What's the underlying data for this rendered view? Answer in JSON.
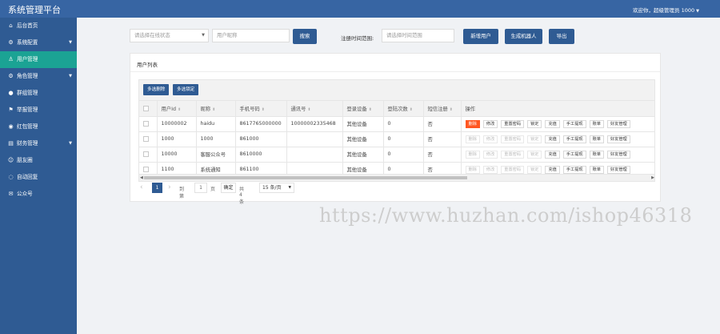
{
  "app": {
    "title": "系统管理平台",
    "welcome": "欢迎你，超级管理员 1000"
  },
  "sidebar": {
    "items": [
      {
        "label": "后台首页",
        "icon": "home-icon",
        "glyph": "⌂",
        "expandable": false,
        "active": false
      },
      {
        "label": "系统配置",
        "icon": "gear-icon",
        "glyph": "⚙",
        "expandable": true,
        "active": false
      },
      {
        "label": "用户管理",
        "icon": "user-icon",
        "glyph": "♙",
        "expandable": false,
        "active": true
      },
      {
        "label": "角色管理",
        "icon": "gear-icon",
        "glyph": "⚙",
        "expandable": true,
        "active": false
      },
      {
        "label": "群组管理",
        "icon": "circle-icon",
        "glyph": "●",
        "expandable": false,
        "active": false
      },
      {
        "label": "举报管理",
        "icon": "flag-icon",
        "glyph": "⚑",
        "expandable": false,
        "active": false
      },
      {
        "label": "红包管理",
        "icon": "radio-icon",
        "glyph": "◉",
        "expandable": false,
        "active": false
      },
      {
        "label": "财务管理",
        "icon": "wallet-icon",
        "glyph": "▤",
        "expandable": true,
        "active": false
      },
      {
        "label": "朋友圈",
        "icon": "friends-icon",
        "glyph": "☺",
        "expandable": false,
        "active": false
      },
      {
        "label": "自动回复",
        "icon": "chat-icon",
        "glyph": "◌",
        "expandable": false,
        "active": false
      },
      {
        "label": "公众号",
        "icon": "mail-icon",
        "glyph": "✉",
        "expandable": false,
        "active": false
      }
    ]
  },
  "filter": {
    "status_placeholder": "请选择在线状态",
    "nickname_placeholder": "用户昵称",
    "search_label": "搜索",
    "time_label": "注册时间范围:",
    "time_placeholder": "请选择时间范围",
    "add_user_label": "新增用户",
    "robot_label": "生成机器人",
    "export_label": "导出"
  },
  "panel": {
    "title": "用户列表",
    "batch_delete_label": "多选删除",
    "batch_lock_label": "多选锁定"
  },
  "table": {
    "columns": [
      "用户Id",
      "昵称",
      "手机号码",
      "通讯号",
      "登录设备",
      "登陆次数",
      "短信注册",
      "操作"
    ],
    "actions": [
      "删除",
      "修改",
      "重置密码",
      "锁定",
      "充值",
      "手工提现",
      "账单",
      "好友管理"
    ],
    "rows": [
      {
        "id": "10000002",
        "nickname": "haidu",
        "phone": "8617765000000",
        "account": "10000002335468",
        "device": "其他设备",
        "logins": "0",
        "sms": "否",
        "active_actions": true
      },
      {
        "id": "1000",
        "nickname": "1000",
        "phone": "861000",
        "account": "",
        "device": "其他设备",
        "logins": "0",
        "sms": "否",
        "active_actions": false
      },
      {
        "id": "10000",
        "nickname": "客服公众号",
        "phone": "8610000",
        "account": "",
        "device": "其他设备",
        "logins": "0",
        "sms": "否",
        "active_actions": false
      },
      {
        "id": "1100",
        "nickname": "系统通知",
        "phone": "861100",
        "account": "",
        "device": "其他设备",
        "logins": "0",
        "sms": "否",
        "active_actions": false
      }
    ]
  },
  "pagination": {
    "prev": "‹",
    "current_page": "1",
    "next": "›",
    "goto_label": "到第",
    "goto_value": "1",
    "page_unit": "页",
    "confirm_label": "确定",
    "total": "共 4 条",
    "page_size": "15 条/页"
  },
  "watermark": "https://www.huzhan.com/ishop46318",
  "colors": {
    "topbar": "#3765a3",
    "sidebar": "#2f5b93",
    "active": "#1ba394",
    "primary": "#2f5b93",
    "danger": "#ff5722"
  }
}
